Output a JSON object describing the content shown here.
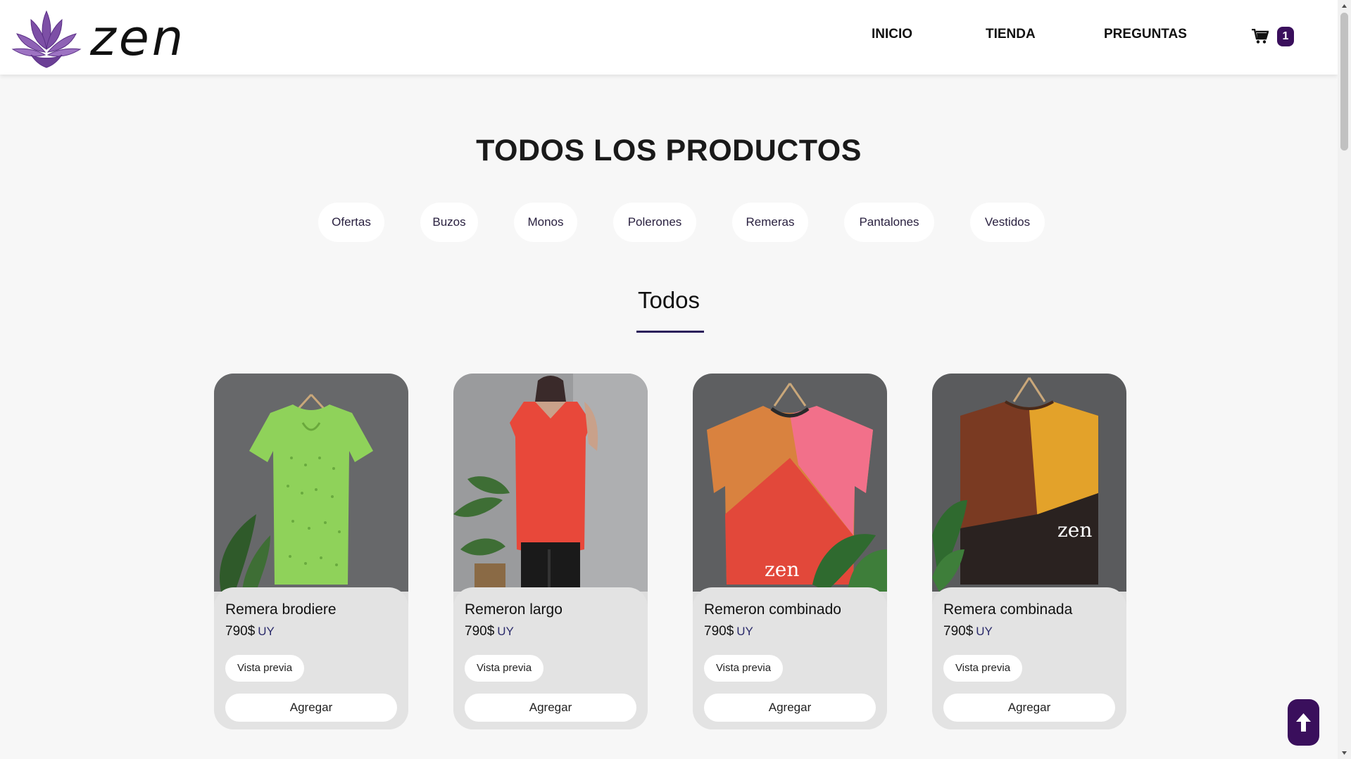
{
  "brand": {
    "name": "zen"
  },
  "nav": {
    "links": [
      "INICIO",
      "TIENDA",
      "PREGUNTAS"
    ],
    "cart_count": "1"
  },
  "page_title": "TODOS LOS PRODUCTOS",
  "categories": [
    "Ofertas",
    "Buzos",
    "Monos",
    "Polerones",
    "Remeras",
    "Pantalones",
    "Vestidos"
  ],
  "section_title": "Todos",
  "products": [
    {
      "name": "Remera brodiere",
      "price": "790$",
      "currency": "UY",
      "preview_label": "Vista previa",
      "add_label": "Agregar"
    },
    {
      "name": "Remeron largo",
      "price": "790$",
      "currency": "UY",
      "preview_label": "Vista previa",
      "add_label": "Agregar"
    },
    {
      "name": "Remeron combinado",
      "price": "790$",
      "currency": "UY",
      "preview_label": "Vista previa",
      "add_label": "Agregar"
    },
    {
      "name": "Remera combinada",
      "price": "790$",
      "currency": "UY",
      "preview_label": "Vista previa",
      "add_label": "Agregar"
    }
  ],
  "image_watermarks": [
    "zen",
    "zen"
  ],
  "colors": {
    "accent": "#3a0f5c",
    "underline": "#2a1d5a",
    "background": "#f7f7f7",
    "card": "#e3e3e3"
  },
  "icons": [
    "lotus-logo-icon",
    "cart-icon",
    "arrow-up-icon"
  ]
}
